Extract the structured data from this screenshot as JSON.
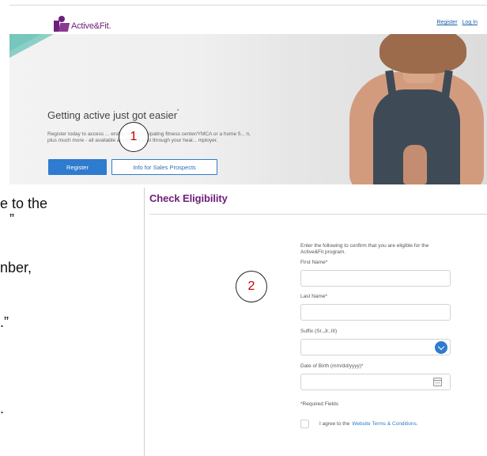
{
  "site": {
    "brand": "Active&Fit.",
    "links": {
      "register": "Register",
      "login": "Log In"
    },
    "hero": {
      "title": "Getting active just got easier",
      "title_mark": "*",
      "description": "Register today to access ... ership at a participating fitness center/YMCA or a home fi... n, plus much more - all available at one low cost through your heal... mployer.",
      "register_label": "Register",
      "sales_label": "Info for Sales Prospects"
    }
  },
  "callouts": {
    "one": "1",
    "two": "2"
  },
  "slide_fragments": [
    "e to the",
    "”",
    "nber,",
    ".”",
    "."
  ],
  "eligibility": {
    "title": "Check Eligibility",
    "intro": "Enter the following to confirm that you are eligible for the Active&Fit program.",
    "first_name_label": "First Name*",
    "last_name_label": "Last Name*",
    "suffix_label": "Suffix (Sr.,Jr.,III)",
    "dob_label": "Date of Birth (mm/dd/yyyy)*",
    "required_note": "*Required Fields",
    "agree_prefix": "I agree to the",
    "agree_link": "Website Terms & Conditions."
  },
  "colors": {
    "brand_purple": "#6d2077",
    "primary_blue": "#2e7bcf",
    "accent_teal": "#8bd0c7",
    "callout_red": "#c00000"
  }
}
